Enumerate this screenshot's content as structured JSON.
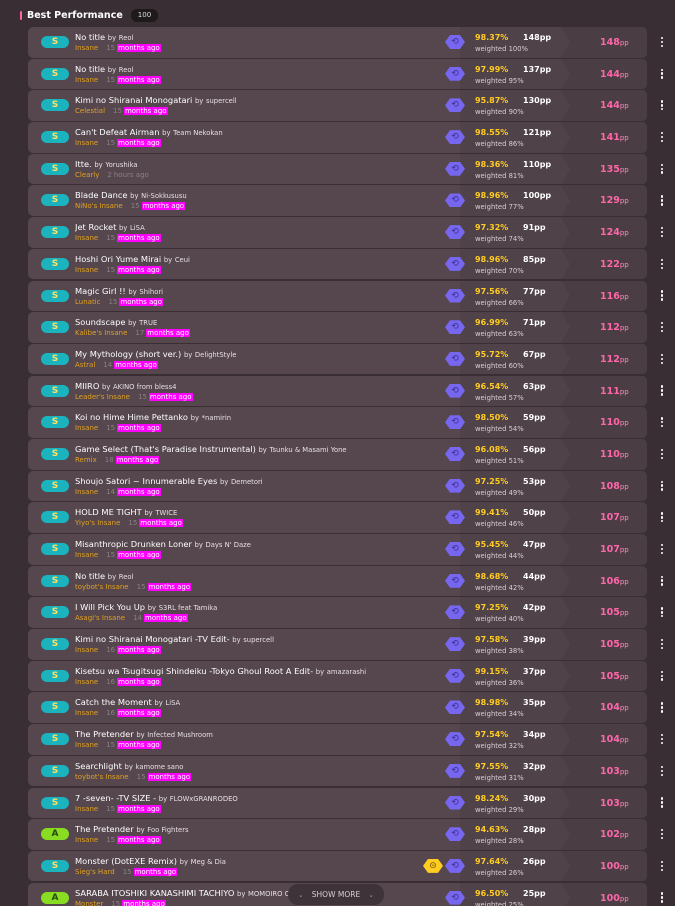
{
  "section": {
    "title": "Best Performance",
    "count": "100"
  },
  "labels": {
    "by": "by",
    "weighted_prefix": "weighted",
    "pp_unit": "pp",
    "ago_suffix": "months ago"
  },
  "show_more": {
    "label": "SHOW MORE"
  },
  "colors": {
    "accent_pink": "#ff66aa",
    "accuracy_yellow": "#ffcc22",
    "rank_S": "#1ab3be",
    "rank_A": "#88dd22",
    "mod_nightcore": "#7766ee",
    "mod_hidden": "#ffcc22",
    "highlight": "#ff00ff"
  },
  "scores": [
    {
      "rank": "S",
      "title": "No title",
      "artist": "Reol",
      "difficulty": "Insane",
      "ago_num": "15",
      "ago_text": "months ago",
      "highlight": true,
      "mods": [
        "nightcore-icon"
      ],
      "accuracy": "98.37%",
      "raw_pp": "148pp",
      "weighted": "weighted 100%",
      "pp": "148"
    },
    {
      "rank": "S",
      "title": "No title",
      "artist": "Reol",
      "difficulty": "Insane",
      "ago_num": "15",
      "ago_text": "months ago",
      "highlight": true,
      "mods": [
        "nightcore-icon"
      ],
      "accuracy": "97.99%",
      "raw_pp": "137pp",
      "weighted": "weighted 95%",
      "pp": "144"
    },
    {
      "rank": "S",
      "title": "Kimi no Shiranai Monogatari",
      "artist": "supercell",
      "difficulty": "Celestial",
      "ago_num": "15",
      "ago_text": "months ago",
      "highlight": true,
      "mods": [
        "nightcore-icon"
      ],
      "accuracy": "95.87%",
      "raw_pp": "130pp",
      "weighted": "weighted 90%",
      "pp": "144"
    },
    {
      "rank": "S",
      "title": "Can't Defeat Airman",
      "artist": "Team Nekokan",
      "difficulty": "Insane",
      "ago_num": "15",
      "ago_text": "months ago",
      "highlight": true,
      "mods": [
        "nightcore-icon"
      ],
      "accuracy": "98.55%",
      "raw_pp": "121pp",
      "weighted": "weighted 86%",
      "pp": "141"
    },
    {
      "rank": "S",
      "title": "Itte.",
      "artist": "Yorushika",
      "difficulty": "Clearly",
      "ago_num": "2",
      "ago_text": "hours ago",
      "highlight": false,
      "mods": [
        "nightcore-icon"
      ],
      "accuracy": "98.36%",
      "raw_pp": "110pp",
      "weighted": "weighted 81%",
      "pp": "135"
    },
    {
      "rank": "S",
      "title": "Blade Dance",
      "artist": "Ni-Sokkususu",
      "difficulty": "NiNo's Insane",
      "ago_num": "15",
      "ago_text": "months ago",
      "highlight": true,
      "mods": [
        "nightcore-icon"
      ],
      "accuracy": "98.96%",
      "raw_pp": "100pp",
      "weighted": "weighted 77%",
      "pp": "129"
    },
    {
      "rank": "S",
      "title": "Jet Rocket",
      "artist": "LiSA",
      "difficulty": "Insane",
      "ago_num": "15",
      "ago_text": "months ago",
      "highlight": true,
      "mods": [
        "nightcore-icon"
      ],
      "accuracy": "97.32%",
      "raw_pp": "91pp",
      "weighted": "weighted 74%",
      "pp": "124"
    },
    {
      "rank": "S",
      "title": "Hoshi Ori Yume Mirai",
      "artist": "Ceui",
      "difficulty": "Insane",
      "ago_num": "15",
      "ago_text": "months ago",
      "highlight": true,
      "mods": [
        "nightcore-icon"
      ],
      "accuracy": "98.96%",
      "raw_pp": "85pp",
      "weighted": "weighted 70%",
      "pp": "122"
    },
    {
      "rank": "S",
      "title": "Magic Girl !!",
      "artist": "Shihori",
      "difficulty": "Lunatic",
      "ago_num": "15",
      "ago_text": "months ago",
      "highlight": true,
      "mods": [
        "nightcore-icon"
      ],
      "accuracy": "97.56%",
      "raw_pp": "77pp",
      "weighted": "weighted 66%",
      "pp": "116"
    },
    {
      "rank": "S",
      "title": "Soundscape",
      "artist": "TRUE",
      "difficulty": "Kalibe's Insane",
      "ago_num": "17",
      "ago_text": "months ago",
      "highlight": true,
      "mods": [
        "nightcore-icon"
      ],
      "accuracy": "96.99%",
      "raw_pp": "71pp",
      "weighted": "weighted 63%",
      "pp": "112"
    },
    {
      "rank": "S",
      "title": "My Mythology (short ver.)",
      "artist": "DelightStyle",
      "difficulty": "Astral",
      "ago_num": "14",
      "ago_text": "months ago",
      "highlight": true,
      "mods": [
        "nightcore-icon"
      ],
      "accuracy": "95.72%",
      "raw_pp": "67pp",
      "weighted": "weighted 60%",
      "pp": "112"
    },
    {
      "rank": "S",
      "title": "MIIRO",
      "artist": "AKINO from bless4",
      "difficulty": "Leader's Insane",
      "ago_num": "15",
      "ago_text": "months ago",
      "highlight": true,
      "mods": [
        "nightcore-icon"
      ],
      "accuracy": "96.54%",
      "raw_pp": "63pp",
      "weighted": "weighted 57%",
      "pp": "111"
    },
    {
      "rank": "S",
      "title": "Koi no Hime Hime Pettanko",
      "artist": "*namirin",
      "difficulty": "Insane",
      "ago_num": "15",
      "ago_text": "months ago",
      "highlight": true,
      "mods": [
        "nightcore-icon"
      ],
      "accuracy": "98.50%",
      "raw_pp": "59pp",
      "weighted": "weighted 54%",
      "pp": "110"
    },
    {
      "rank": "S",
      "title": "Game Select (That's Paradise Instrumental)",
      "artist": "Tsunku & Masami Yone",
      "difficulty": "Remix",
      "ago_num": "18",
      "ago_text": "months ago",
      "highlight": true,
      "mods": [
        "nightcore-icon"
      ],
      "accuracy": "96.08%",
      "raw_pp": "56pp",
      "weighted": "weighted 51%",
      "pp": "110"
    },
    {
      "rank": "S",
      "title": "Shoujo Satori ~ Innumerable Eyes",
      "artist": "Demetori",
      "difficulty": "Insane",
      "ago_num": "14",
      "ago_text": "months ago",
      "highlight": true,
      "mods": [
        "nightcore-icon"
      ],
      "accuracy": "97.25%",
      "raw_pp": "53pp",
      "weighted": "weighted 49%",
      "pp": "108"
    },
    {
      "rank": "S",
      "title": "HOLD ME TIGHT",
      "artist": "TWICE",
      "difficulty": "Yiyo's Insane",
      "ago_num": "15",
      "ago_text": "months ago",
      "highlight": true,
      "mods": [
        "nightcore-icon"
      ],
      "accuracy": "99.41%",
      "raw_pp": "50pp",
      "weighted": "weighted 46%",
      "pp": "107"
    },
    {
      "rank": "S",
      "title": "Misanthropic Drunken Loner",
      "artist": "Days N' Daze",
      "difficulty": "Insane",
      "ago_num": "15",
      "ago_text": "months ago",
      "highlight": true,
      "mods": [
        "nightcore-icon"
      ],
      "accuracy": "95.45%",
      "raw_pp": "47pp",
      "weighted": "weighted 44%",
      "pp": "107"
    },
    {
      "rank": "S",
      "title": "No title",
      "artist": "Reol",
      "difficulty": "toybot's Insane",
      "ago_num": "15",
      "ago_text": "months ago",
      "highlight": true,
      "mods": [
        "nightcore-icon"
      ],
      "accuracy": "98.68%",
      "raw_pp": "44pp",
      "weighted": "weighted 42%",
      "pp": "106"
    },
    {
      "rank": "S",
      "title": "I Will Pick You Up",
      "artist": "S3RL feat Tamika",
      "difficulty": "Asagi's Insane",
      "ago_num": "14",
      "ago_text": "months ago",
      "highlight": true,
      "mods": [
        "nightcore-icon"
      ],
      "accuracy": "97.25%",
      "raw_pp": "42pp",
      "weighted": "weighted 40%",
      "pp": "105"
    },
    {
      "rank": "S",
      "title": "Kimi no Shiranai Monogatari -TV Edit-",
      "artist": "supercell",
      "difficulty": "Insane",
      "ago_num": "16",
      "ago_text": "months ago",
      "highlight": true,
      "mods": [
        "nightcore-icon"
      ],
      "accuracy": "97.58%",
      "raw_pp": "39pp",
      "weighted": "weighted 38%",
      "pp": "105"
    },
    {
      "rank": "S",
      "title": "Kisetsu wa Tsugitsugi Shindeiku -Tokyo Ghoul Root A Edit-",
      "artist": "amazarashi",
      "difficulty": "Insane",
      "ago_num": "16",
      "ago_text": "months ago",
      "highlight": true,
      "mods": [
        "nightcore-icon"
      ],
      "accuracy": "99.15%",
      "raw_pp": "37pp",
      "weighted": "weighted 36%",
      "pp": "105"
    },
    {
      "rank": "S",
      "title": "Catch the Moment",
      "artist": "LiSA",
      "difficulty": "Insane",
      "ago_num": "16",
      "ago_text": "months ago",
      "highlight": true,
      "mods": [
        "nightcore-icon"
      ],
      "accuracy": "98.98%",
      "raw_pp": "35pp",
      "weighted": "weighted 34%",
      "pp": "104"
    },
    {
      "rank": "S",
      "title": "The Pretender",
      "artist": "Infected Mushroom",
      "difficulty": "Insane",
      "ago_num": "15",
      "ago_text": "months ago",
      "highlight": true,
      "mods": [
        "nightcore-icon"
      ],
      "accuracy": "97.54%",
      "raw_pp": "34pp",
      "weighted": "weighted 32%",
      "pp": "104"
    },
    {
      "rank": "S",
      "title": "Searchlight",
      "artist": "kamome sano",
      "difficulty": "toybot's Insane",
      "ago_num": "15",
      "ago_text": "months ago",
      "highlight": true,
      "mods": [
        "nightcore-icon"
      ],
      "accuracy": "97.55%",
      "raw_pp": "32pp",
      "weighted": "weighted 31%",
      "pp": "103"
    },
    {
      "rank": "S",
      "title": "7 -seven- -TV SIZE -",
      "artist": "FLOWxGRANRODEO",
      "difficulty": "Insane",
      "ago_num": "15",
      "ago_text": "months ago",
      "highlight": true,
      "mods": [
        "nightcore-icon"
      ],
      "accuracy": "98.24%",
      "raw_pp": "30pp",
      "weighted": "weighted 29%",
      "pp": "103"
    },
    {
      "rank": "A",
      "title": "The Pretender",
      "artist": "Foo Fighters",
      "difficulty": "Insane",
      "ago_num": "15",
      "ago_text": "months ago",
      "highlight": true,
      "mods": [
        "nightcore-icon"
      ],
      "accuracy": "94.63%",
      "raw_pp": "28pp",
      "weighted": "weighted 28%",
      "pp": "102"
    },
    {
      "rank": "S",
      "title": "Monster (DotEXE Remix)",
      "artist": "Meg & Dia",
      "difficulty": "Sieg's Hard",
      "ago_num": "15",
      "ago_text": "months ago",
      "highlight": true,
      "mods": [
        "hidden-icon",
        "nightcore-icon"
      ],
      "accuracy": "97.64%",
      "raw_pp": "26pp",
      "weighted": "weighted 26%",
      "pp": "100"
    },
    {
      "rank": "A",
      "title": "SARABA ITOSHIKI KANASHIMI TACHIYO",
      "artist": "MOMOIRO CLOVER Z",
      "difficulty": "Monster",
      "ago_num": "15",
      "ago_text": "months ago",
      "highlight": true,
      "mods": [
        "nightcore-icon"
      ],
      "accuracy": "96.50%",
      "raw_pp": "25pp",
      "weighted": "weighted 25%",
      "pp": "100"
    }
  ]
}
